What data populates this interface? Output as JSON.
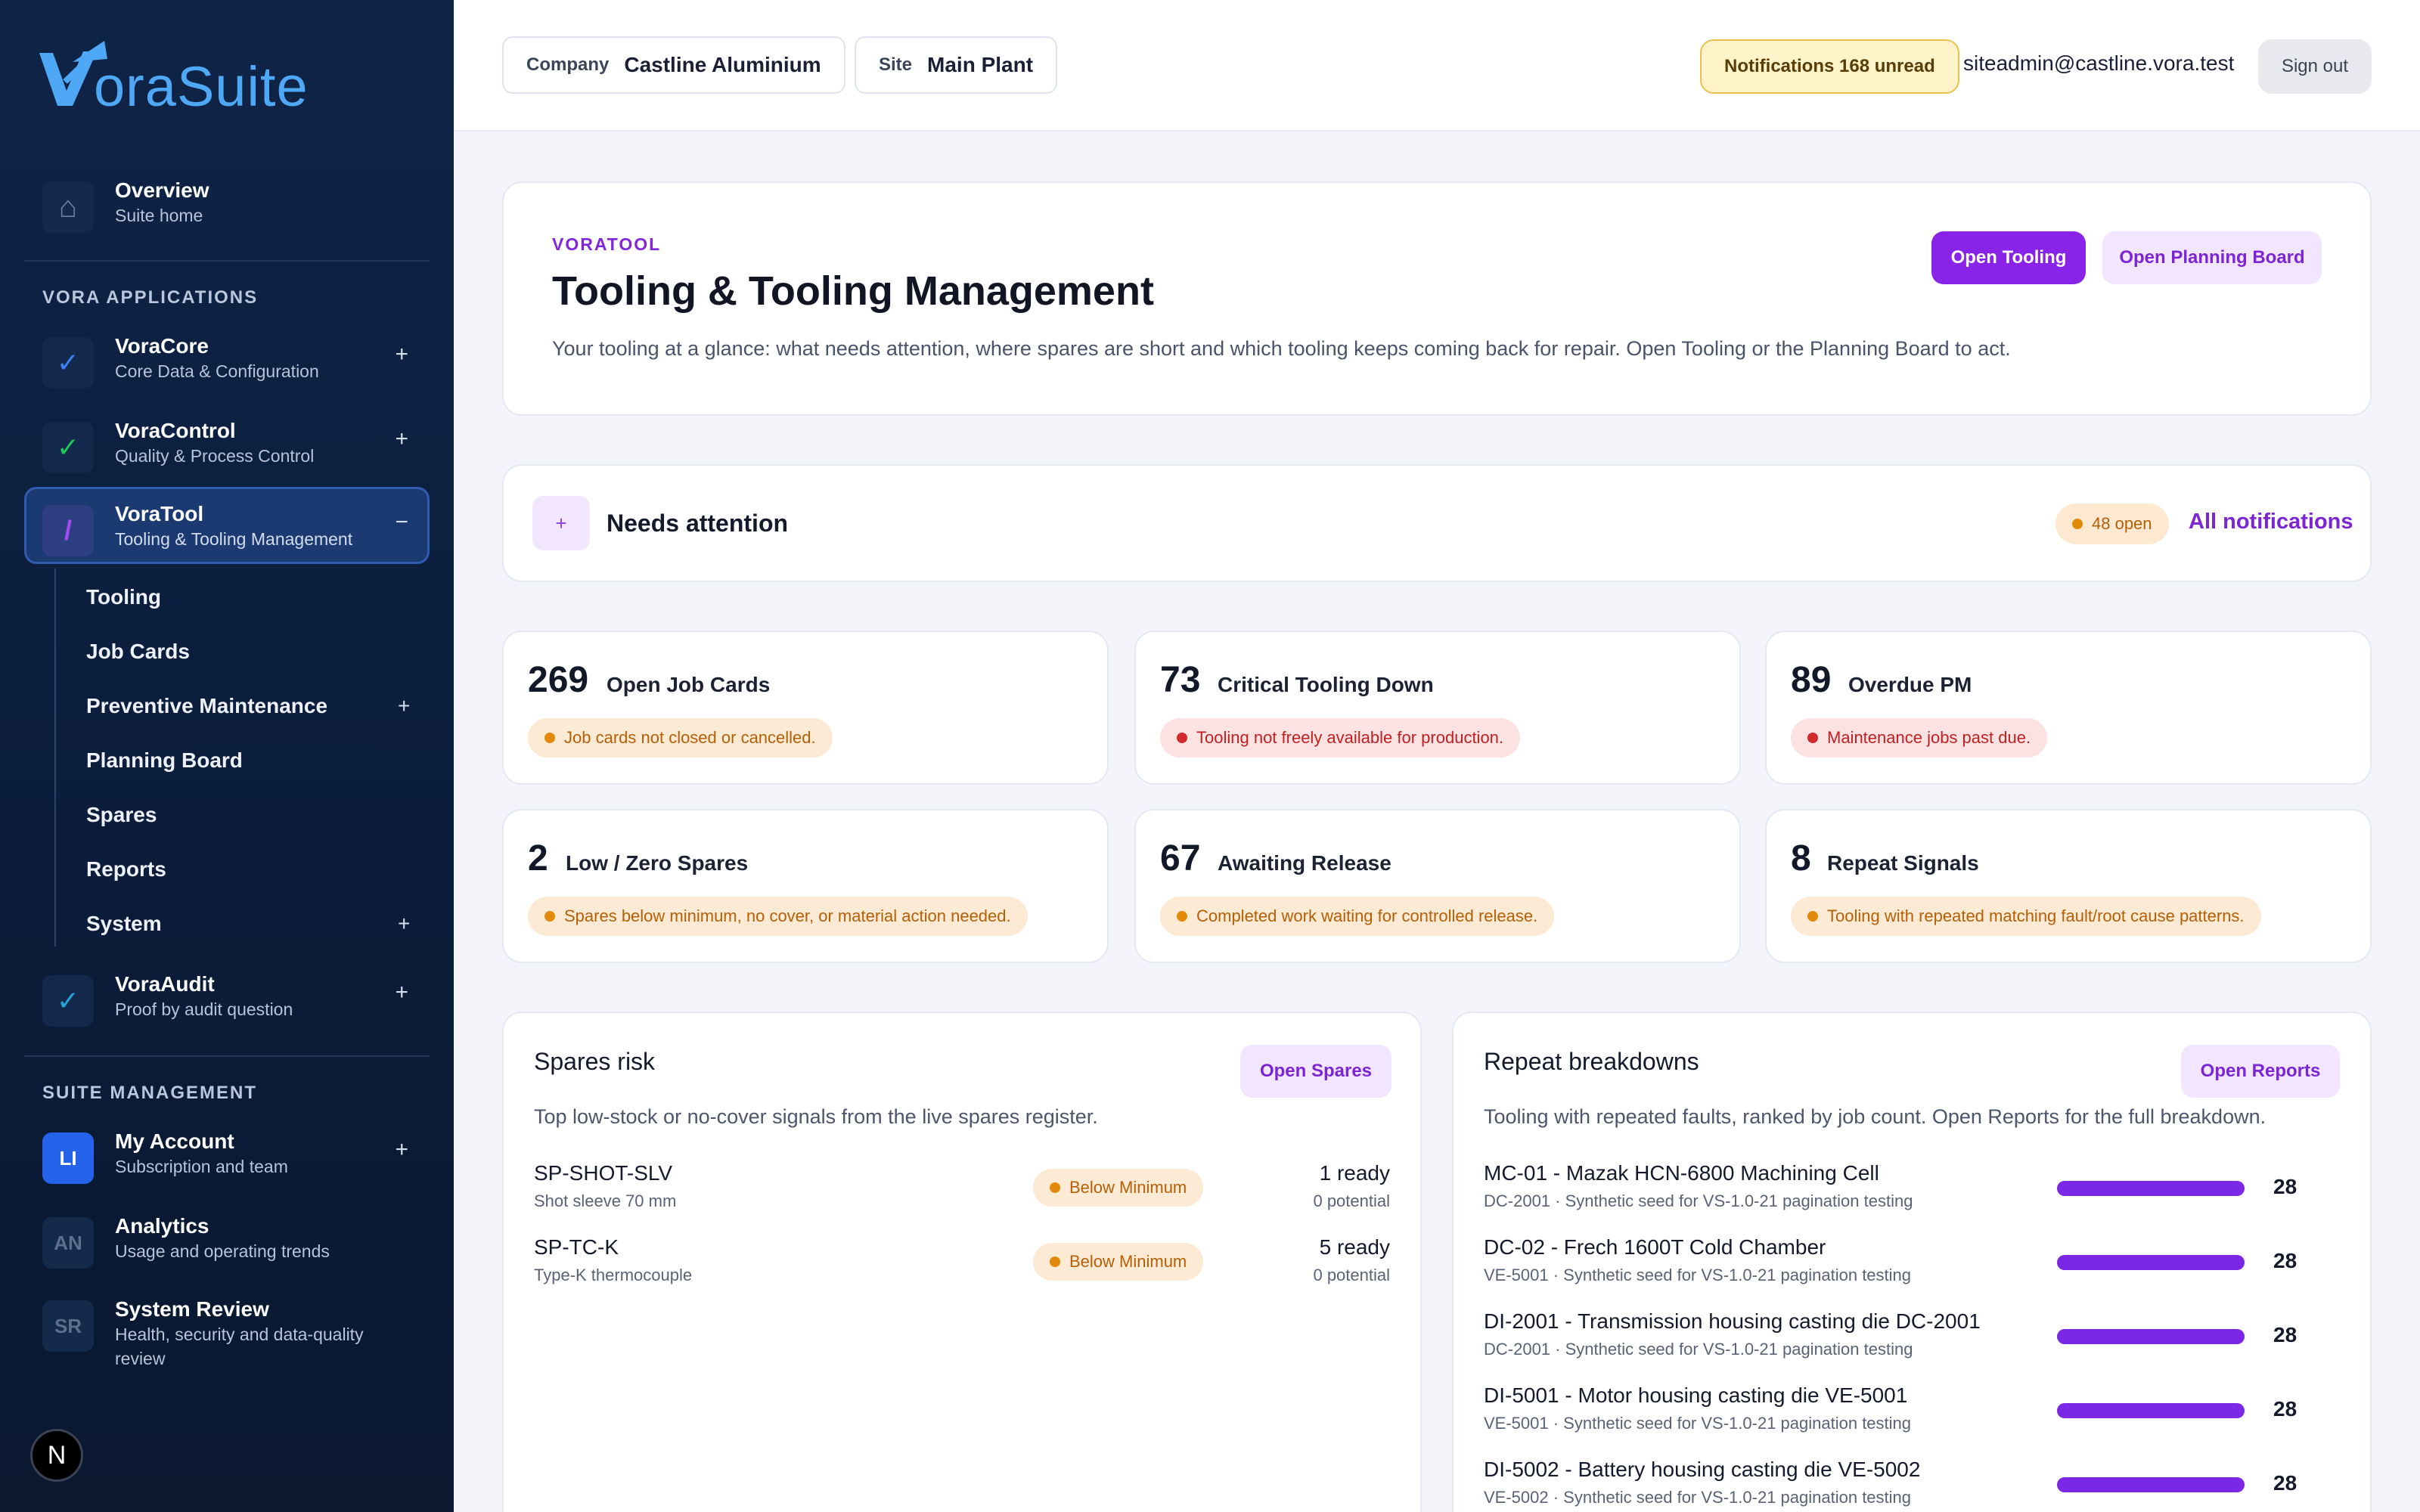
{
  "brand": {
    "name": "oraSuite"
  },
  "sidebar": {
    "overview": {
      "title": "Overview",
      "subtitle": "Suite home"
    },
    "section_apps": "VORA APPLICATIONS",
    "apps": [
      {
        "title": "VoraCore",
        "subtitle": "Core Data & Configuration",
        "toggle": "+"
      },
      {
        "title": "VoraControl",
        "subtitle": "Quality & Process Control",
        "toggle": "+"
      },
      {
        "title": "VoraTool",
        "subtitle": "Tooling & Tooling Management",
        "toggle": "−"
      },
      {
        "title": "VoraAudit",
        "subtitle": "Proof by audit question",
        "toggle": "+"
      }
    ],
    "voratool_subnav": [
      {
        "label": "Tooling"
      },
      {
        "label": "Job Cards"
      },
      {
        "label": "Preventive Maintenance",
        "toggle": "+"
      },
      {
        "label": "Planning Board"
      },
      {
        "label": "Spares"
      },
      {
        "label": "Reports"
      },
      {
        "label": "System",
        "toggle": "+"
      }
    ],
    "section_suite": "SUITE MANAGEMENT",
    "suite": [
      {
        "initials": "LI",
        "title": "My Account",
        "subtitle": "Subscription and team",
        "toggle": "+"
      },
      {
        "initials": "AN",
        "title": "Analytics",
        "subtitle": "Usage and operating trends"
      },
      {
        "initials": "SR",
        "title": "System Review",
        "subtitle": "Health, security and data-quality",
        "subtitle2": "review"
      }
    ],
    "fab_letter": "N"
  },
  "topbar": {
    "company_label": "Company",
    "company_value": "Castline Aluminium",
    "site_label": "Site",
    "site_value": "Main Plant",
    "notifications": "Notifications 168 unread",
    "user_email": "siteadmin@castline.vora.test",
    "sign_out": "Sign out"
  },
  "hero": {
    "eyebrow": "VORATOOL",
    "title": "Tooling & Tooling Management",
    "description": "Your tooling at a glance: what needs attention, where spares are short and which tooling keeps coming back for repair. Open Tooling or the Planning Board to act.",
    "open_tooling": "Open Tooling",
    "open_planning": "Open Planning Board"
  },
  "attention": {
    "icon": "+",
    "title": "Needs attention",
    "pill": "48 open",
    "link": "All notifications"
  },
  "kpis": [
    {
      "value": "269",
      "label": "Open Job Cards",
      "note": "Job cards not closed or cancelled.",
      "tone": "amber"
    },
    {
      "value": "73",
      "label": "Critical Tooling Down",
      "note": "Tooling not freely available for production.",
      "tone": "red"
    },
    {
      "value": "89",
      "label": "Overdue PM",
      "note": "Maintenance jobs past due.",
      "tone": "red"
    },
    {
      "value": "2",
      "label": "Low / Zero Spares",
      "note": "Spares below minimum, no cover, or material action needed.",
      "tone": "amber"
    },
    {
      "value": "67",
      "label": "Awaiting Release",
      "note": "Completed work waiting for controlled release.",
      "tone": "amber"
    },
    {
      "value": "8",
      "label": "Repeat Signals",
      "note": "Tooling with repeated matching fault/root cause patterns.",
      "tone": "amber"
    }
  ],
  "spares": {
    "title": "Spares risk",
    "button": "Open Spares",
    "description": "Top low-stock or no-cover signals from the live spares register.",
    "rows": [
      {
        "code": "SP-SHOT-SLV",
        "name": "Shot sleeve 70 mm",
        "status": "Below Minimum",
        "ready": "1 ready",
        "potential": "0 potential"
      },
      {
        "code": "SP-TC-K",
        "name": "Type-K thermocouple",
        "status": "Below Minimum",
        "ready": "5 ready",
        "potential": "0 potential"
      }
    ]
  },
  "repeats": {
    "title": "Repeat breakdowns",
    "button": "Open Reports",
    "description": "Tooling with repeated faults, ranked by job count. Open Reports for the full breakdown.",
    "max": 28,
    "rows": [
      {
        "title": "MC-01 - Mazak HCN-6800 Machining Cell",
        "sub": "DC-2001 · Synthetic seed for VS-1.0-21 pagination testing",
        "count": 28
      },
      {
        "title": "DC-02 - Frech 1600T Cold Chamber",
        "sub": "VE-5001 · Synthetic seed for VS-1.0-21 pagination testing",
        "count": 28
      },
      {
        "title": "DI-2001 - Transmission housing casting die DC-2001",
        "sub": "DC-2001 · Synthetic seed for VS-1.0-21 pagination testing",
        "count": 28
      },
      {
        "title": "DI-5001 - Motor housing casting die VE-5001",
        "sub": "VE-5001 · Synthetic seed for VS-1.0-21 pagination testing",
        "count": 28
      },
      {
        "title": "DI-5002 - Battery housing casting die VE-5002",
        "sub": "VE-5002 · Synthetic seed for VS-1.0-21 pagination testing",
        "count": 28
      }
    ]
  },
  "colors": {
    "accent": "#8a23e8",
    "sidebar": "#0b1d3b",
    "brand_blue": "#4fa8f5",
    "amber": "#e28a0c",
    "red": "#d12a2e"
  }
}
